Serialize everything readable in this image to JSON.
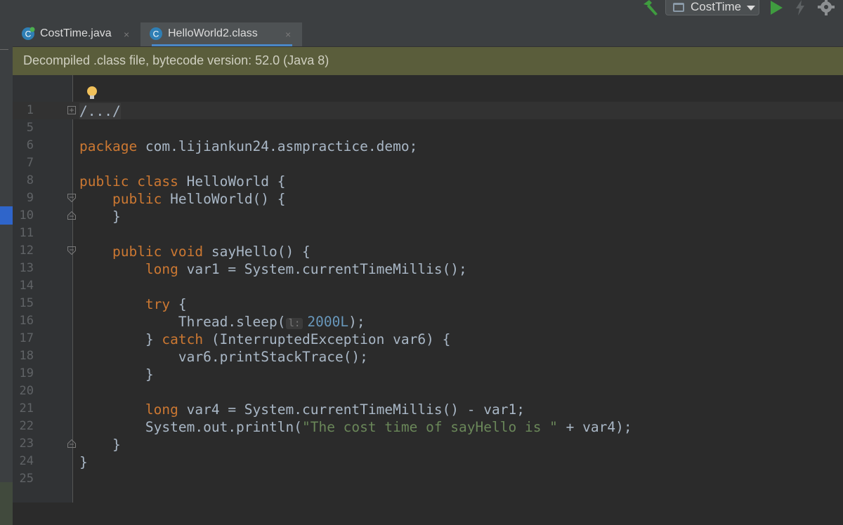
{
  "toolbar": {
    "run_config_label": "CostTime"
  },
  "tabs": [
    {
      "label": "CostTime.java",
      "close": "×",
      "icon": "java-class-icon"
    },
    {
      "label": "HelloWorld2.class",
      "close": "×",
      "icon": "class-file-icon"
    }
  ],
  "banner": {
    "text": "Decompiled .class file, bytecode version: 52.0 (Java 8)"
  },
  "editor": {
    "lines": [
      {
        "num": "1"
      },
      {
        "num": "5"
      },
      {
        "num": "6"
      },
      {
        "num": "7"
      },
      {
        "num": "8"
      },
      {
        "num": "9"
      },
      {
        "num": "10"
      },
      {
        "num": "11"
      },
      {
        "num": "12"
      },
      {
        "num": "13"
      },
      {
        "num": "14"
      },
      {
        "num": "15"
      },
      {
        "num": "16"
      },
      {
        "num": "17"
      },
      {
        "num": "18"
      },
      {
        "num": "19"
      },
      {
        "num": "20"
      },
      {
        "num": "21"
      },
      {
        "num": "22"
      },
      {
        "num": "23"
      },
      {
        "num": "24"
      },
      {
        "num": "25"
      }
    ],
    "tokens": {
      "fold_header": "/.../",
      "kw_package": "package",
      "package_name": " com.lijiankun24.asmpractice.demo;",
      "kw_public": "public",
      "kw_class": "class",
      "kw_void": "void",
      "kw_long": "long",
      "kw_try": "try",
      "kw_catch": "catch",
      "class_decl": " HelloWorld {",
      "ctor_decl": " HelloWorld() {",
      "close_brace": "}",
      "method_name": " sayHello() {",
      "var1_decl": " var1 = System.currentTimeMillis();",
      "try_open": " {",
      "sleep_call": "Thread.sleep(",
      "param_hint": "l:",
      "sleep_arg": "2000L",
      "sleep_end": ");",
      "catch_prefix": "} ",
      "catch_rest": " (InterruptedException var6) {",
      "print_stack": "var6.printStackTrace();",
      "var4_decl": " var4 = System.currentTimeMillis() - var1;",
      "println_start": "System.out.println(",
      "println_string": "\"The cost time of sayHello is \"",
      "println_end": " + var4);"
    }
  },
  "colors": {
    "keyword": "#cc7832",
    "string": "#6a8759",
    "number": "#6897bb",
    "identifier": "#a9b7c6",
    "banner_bg": "#5a5d3b",
    "active_tab_underline": "#4a88c7",
    "run_green": "#3f9c3f"
  }
}
